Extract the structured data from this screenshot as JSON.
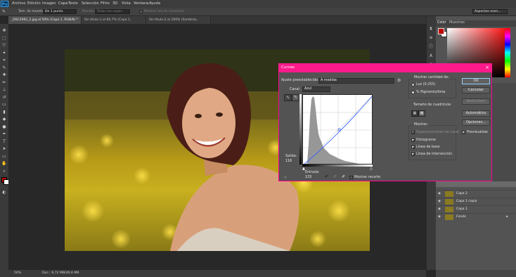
{
  "app": {
    "logo": "Ps"
  },
  "menu": [
    "Archivo",
    "Edición",
    "Imagen",
    "Capa",
    "Texto",
    "Selección",
    "Filtro",
    "3D",
    "Vista",
    "Ventana",
    "Ayuda"
  ],
  "options_bar": {
    "sample_size_label": "Tam. de muestra:",
    "sample_size_value": "De 1 punto",
    "sample_label": "Muestra:",
    "sample_value": "Todas las capas",
    "show_ring": "Mostrar aro de muestreo",
    "workspace": "Aspectos esen..."
  },
  "doc_tabs": [
    {
      "label": "_DSC2062_2.jpg al 50% (Capa 1, RGB/8) *",
      "active": true
    },
    {
      "label": "Sin título-1 al 66,7% (Capa 1, RGB/8#) *",
      "active": false
    },
    {
      "label": "Sin título-2 al 200% (Sombras, RGB/8#) *",
      "active": false
    }
  ],
  "status": {
    "zoom": "50%",
    "doc": "Doc.: 9,72 MB/46,6 MB"
  },
  "color_panel": {
    "tab_color": "Color",
    "tab_swatches": "Muestras",
    "fg_color": "#c00000",
    "bg_color": "#ffffff"
  },
  "layers": [
    {
      "name": "Capa 2"
    },
    {
      "name": "Capa 1 copia"
    },
    {
      "name": "Capa 1"
    },
    {
      "name": "Fondo",
      "italic": true
    }
  ],
  "curves": {
    "title": "Curvas",
    "close": "×",
    "preset_label": "Ajuste preestablecido:",
    "preset_value": "A medida",
    "channel_label": "Canal:",
    "channel_value": "Azul",
    "output_label": "Salida:",
    "output_value": "116",
    "input_label": "Entrada:",
    "input_value": "133",
    "show_clipping": "Mostrar recorte",
    "show_amount_label": "Mostrar cantidad de:",
    "light_option": "Luz (0-255)",
    "pigment_option": "% Pigmento/tinta",
    "grid_size_label": "Tamaño de cuadrícula:",
    "show_label": "Mostrar:",
    "overlay_channels": "Superposiciones de canal",
    "histogram": "Histograma",
    "baseline": "Línea de base",
    "intersection": "Línea de intersección",
    "ok": "OK",
    "cancel": "Cancelar",
    "smooth": "Redondear",
    "auto": "Automático",
    "options": "Opciones...",
    "preview": "Previsualizar"
  }
}
